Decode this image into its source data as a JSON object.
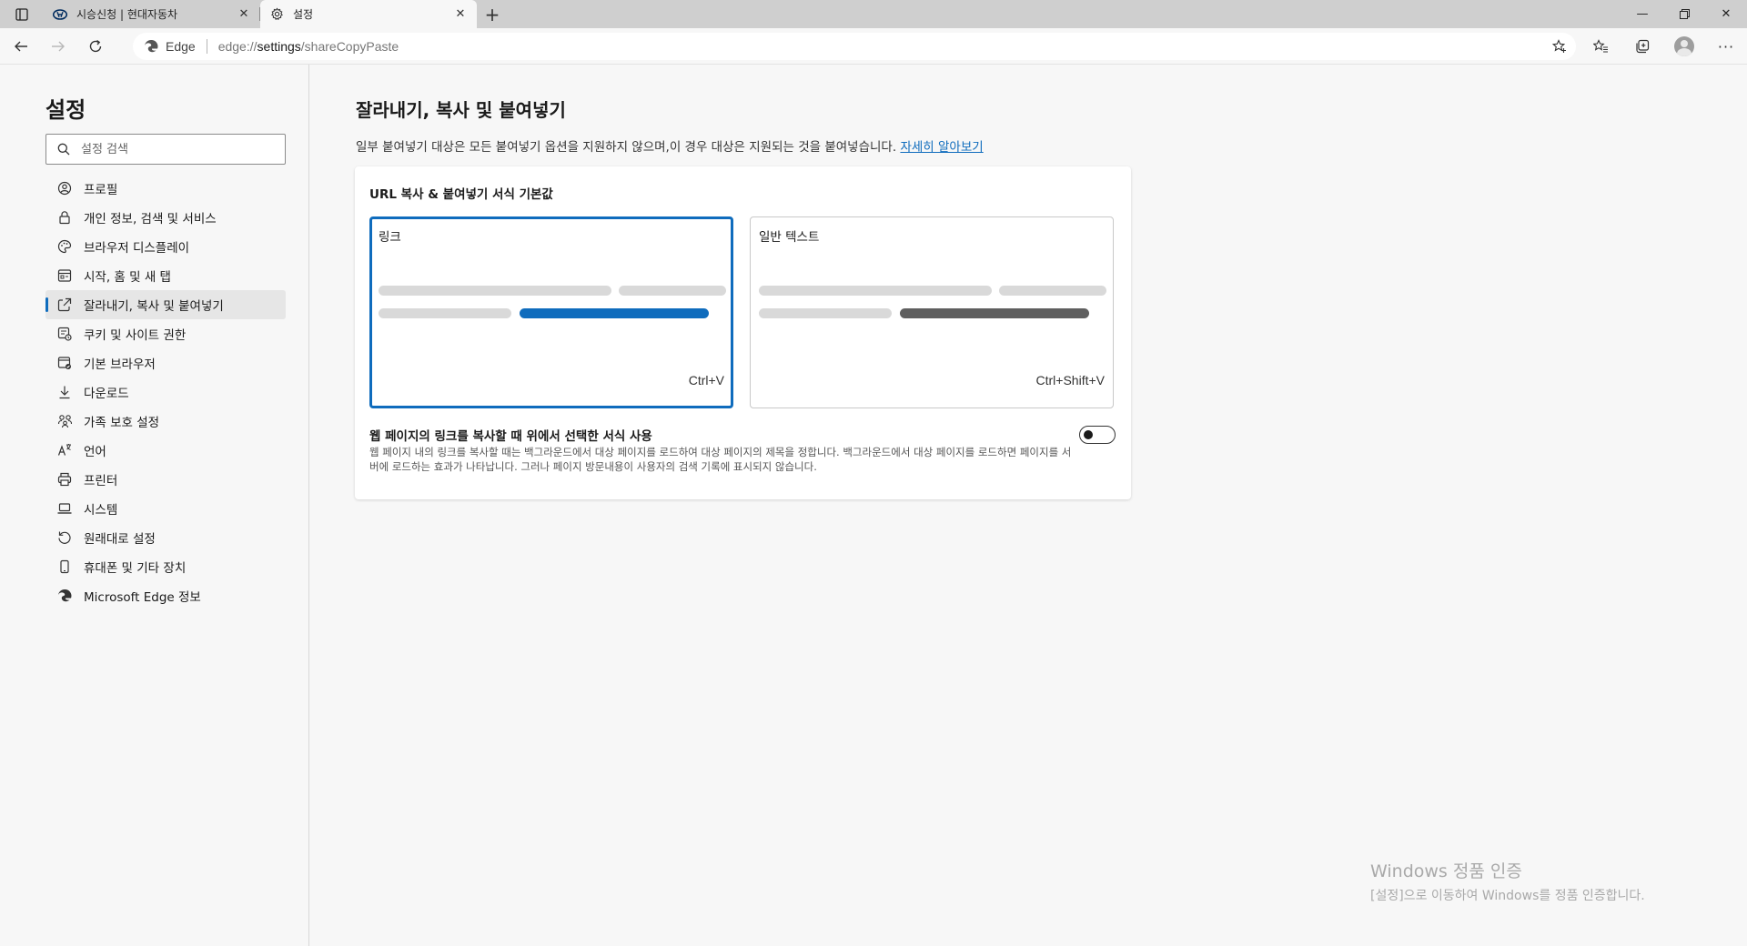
{
  "tabs": [
    {
      "title": "시승신청 | 현대자동차",
      "active": false,
      "icon": "hyundai-logo-icon"
    },
    {
      "title": "설정",
      "active": true,
      "icon": "gear-icon"
    }
  ],
  "toolbar": {
    "site_label": "Edge",
    "url_prefix": "edge://",
    "url_host": "settings",
    "url_path": "/shareCopyPaste"
  },
  "sidebar": {
    "title": "설정",
    "search_placeholder": "설정 검색",
    "items": [
      {
        "label": "프로필",
        "icon": "profile-icon"
      },
      {
        "label": "개인 정보, 검색 및 서비스",
        "icon": "lock-icon"
      },
      {
        "label": "브라우저 디스플레이",
        "icon": "palette-icon"
      },
      {
        "label": "시작, 홈 및 새 탭",
        "icon": "home-tab-icon"
      },
      {
        "label": "잘라내기, 복사 및 붙여넣기",
        "icon": "share-icon",
        "selected": true
      },
      {
        "label": "쿠키 및 사이트 권한",
        "icon": "cookie-icon"
      },
      {
        "label": "기본 브라우저",
        "icon": "browser-icon"
      },
      {
        "label": "다운로드",
        "icon": "download-icon"
      },
      {
        "label": "가족 보호 설정",
        "icon": "family-icon"
      },
      {
        "label": "언어",
        "icon": "language-icon"
      },
      {
        "label": "프린터",
        "icon": "printer-icon"
      },
      {
        "label": "시스템",
        "icon": "laptop-icon"
      },
      {
        "label": "원래대로 설정",
        "icon": "reset-icon"
      },
      {
        "label": "휴대폰 및 기타 장치",
        "icon": "phone-icon"
      },
      {
        "label": "Microsoft Edge 정보",
        "icon": "edge-logo-icon"
      }
    ]
  },
  "main": {
    "title": "잘라내기, 복사 및 붙여넣기",
    "description": "일부 붙여넣기 대상은 모든 붙여넣기 옵션을 지원하지 않으며,이 경우 대상은 지원되는 것을 붙여넣습니다.",
    "learn_more": "자세히 알아보기",
    "card": {
      "title": "URL 복사 & 붙여넣기 서식 기본값",
      "options": [
        {
          "label": "링크",
          "shortcut": "Ctrl+V",
          "selected": true
        },
        {
          "label": "일반 텍스트",
          "shortcut": "Ctrl+Shift+V",
          "selected": false
        }
      ],
      "toggle_title": "웹 페이지의 링크를 복사할 때 위에서 선택한 서식 사용",
      "toggle_desc": "웹 페이지 내의 링크를 복사할 때는 백그라운드에서 대상 페이지를 로드하여 대상 페이지의 제목을 정합니다. 백그라운드에서 대상 페이지를 로드하면 페이지를 서버에 로드하는 효과가 나타납니다. 그러나 페이지 방문내용이 사용자의 검색 기록에 표시되지 않습니다.",
      "toggle_on": false
    }
  },
  "watermark": {
    "line1": "Windows 정품 인증",
    "line2": "[설정]으로 이동하여 Windows를 정품 인증합니다."
  },
  "colors": {
    "accent": "#0f6cbd",
    "plain_text_bar": "#5f5f5f",
    "placeholder_bar": "#d9d9d9"
  }
}
